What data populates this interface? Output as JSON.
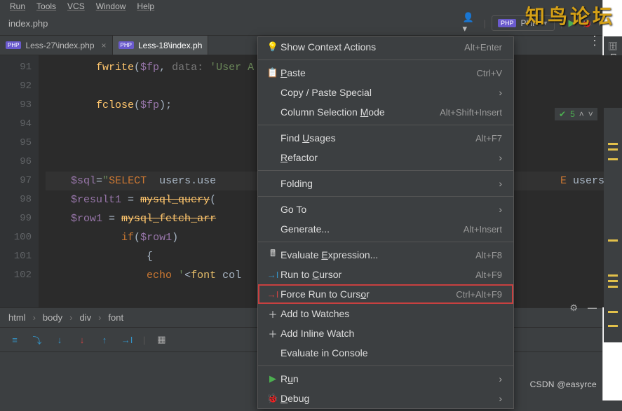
{
  "menubar": [
    "un",
    "ools",
    "VC",
    "indow",
    "elp"
  ],
  "title": "index.php",
  "run_config_label": "PHP",
  "tabs": [
    {
      "label": "Less-27\\index.php",
      "active": false
    },
    {
      "label": "Less-18\\index.ph",
      "active": true
    }
  ],
  "inspection_count": "5",
  "gutter_lines": [
    "91",
    "92",
    "93",
    "94",
    "95",
    "96",
    "97",
    "98",
    "99",
    "100",
    "101",
    "102"
  ],
  "code": {
    "l91_pre": "        ",
    "l91_func": "fwrite",
    "l91_open": "(",
    "l91_var": "$fp",
    "l91_comma": ",",
    "l91_hint": " data: ",
    "l91_str": "'User A",
    "l93_pre": "        ",
    "l93_func": "fclose",
    "l93_open": "(",
    "l93_var": "$fp",
    "l93_close": ");",
    "l97_pre": "    ",
    "l97_var": "$sql",
    "l97_eq": "=",
    "l97_q": "\"",
    "l97_select": "SELECT ",
    "l97_cols": " users.use",
    "l97_tail": "E ",
    "l97_tailcol": "users.us",
    "l98_pre": "    ",
    "l98_var": "$result1",
    "l98_eq": " = ",
    "l98_fn": "mysql_query",
    "l98_open": "(",
    "l99_pre": "    ",
    "l99_var": "$row1",
    "l99_eq": " = ",
    "l99_fn": "mysql_fetch_arr",
    "l100_pre": "            ",
    "l100_if": "if",
    "l100_open": "(",
    "l100_var": "$row1",
    "l100_close": ")",
    "l101_pre": "                {",
    "l102_pre": "                ",
    "l102_echo": "echo ",
    "l102_q": "'",
    "l102_tag_open": "<",
    "l102_tag": "font",
    "l102_attr": " col"
  },
  "breadcrumb": [
    "html",
    "body",
    "div",
    "font"
  ],
  "side_tools": {
    "db": "Database",
    "noti": "Notifications"
  },
  "context_menu": {
    "groups": [
      [
        {
          "icon": "bulb",
          "label": "Show Context Actions",
          "shortcut": "Alt+Enter"
        }
      ],
      [
        {
          "icon": "clipboard",
          "label": "Paste",
          "u": 0,
          "shortcut": "Ctrl+V"
        },
        {
          "label": "Copy / Paste Special",
          "arrow": true
        },
        {
          "label": "Column Selection Mode",
          "u": 17,
          "shortcut": "Alt+Shift+Insert"
        }
      ],
      [
        {
          "label": "Find Usages",
          "u": 5,
          "shortcut": "Alt+F7"
        },
        {
          "label": "Refactor",
          "u": 0,
          "arrow": true
        }
      ],
      [
        {
          "label": "Folding",
          "arrow": true
        }
      ],
      [
        {
          "label": "Go To",
          "arrow": true
        },
        {
          "label": "Generate...",
          "shortcut": "Alt+Insert"
        }
      ],
      [
        {
          "icon": "calc",
          "label": "Evaluate Expression...",
          "u": 9,
          "shortcut": "Alt+F8"
        },
        {
          "icon": "runto",
          "label": "Run to Cursor",
          "u": 7,
          "shortcut": "Alt+F9"
        },
        {
          "icon": "forcerun",
          "label": "Force Run to Cursor",
          "u": 17,
          "shortcut": "Ctrl+Alt+F9",
          "highlight": true
        },
        {
          "icon": "plus",
          "label": "Add to Watches"
        },
        {
          "icon": "plus",
          "label": "Add Inline Watch"
        },
        {
          "label": "Evaluate in Console"
        }
      ],
      [
        {
          "icon": "play",
          "label": "Run",
          "u": 1,
          "arrow": true
        },
        {
          "icon": "bug",
          "label": "Debug",
          "u": 0,
          "arrow": true
        }
      ]
    ]
  },
  "watermark": "CSDN @easyrce"
}
